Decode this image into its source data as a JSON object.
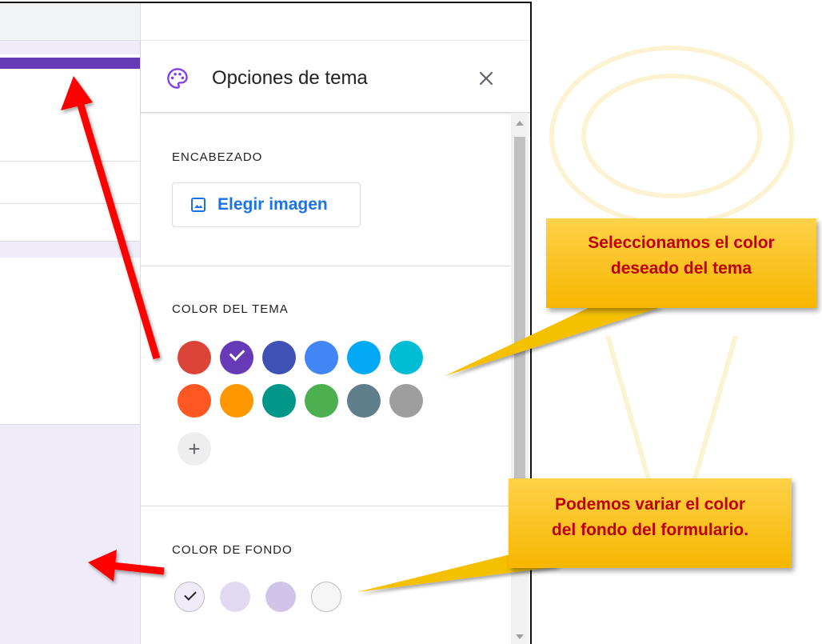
{
  "panel": {
    "title": "Opciones de tema",
    "header_section": {
      "label": "ENCABEZADO",
      "button_label": "Elegir imagen"
    },
    "theme_color_section": {
      "label": "COLOR DEL TEMA",
      "colors": [
        "#db4437",
        "#673ab7",
        "#3f51b5",
        "#4285f4",
        "#03a9f4",
        "#00bcd4",
        "#ff5722",
        "#ff9800",
        "#009688",
        "#4caf50",
        "#607d8b",
        "#9e9e9e"
      ],
      "selected_index": 1,
      "add_label": "+"
    },
    "background_section": {
      "label": "COLOR DE FONDO",
      "colors": [
        "#f0ebf8",
        "#e1d8f1",
        "#d1c4e9",
        "#f6f6f6"
      ],
      "selected_index": 0
    }
  },
  "callouts": {
    "theme": {
      "line1": "Seleccionamos el color",
      "line2": "deseado del tema"
    },
    "background": {
      "line1": "Podemos variar el color",
      "line2": "del fondo del formulario."
    }
  },
  "colors": {
    "accent": "#673ab7",
    "link": "#1a73e8",
    "callout_text": "#c00000",
    "callout_fill": "#ffc000",
    "arrow": "#ff0000"
  },
  "icons": {
    "panel_icon": "palette-icon",
    "close": "close-icon",
    "image_button_icon": "image-icon"
  }
}
